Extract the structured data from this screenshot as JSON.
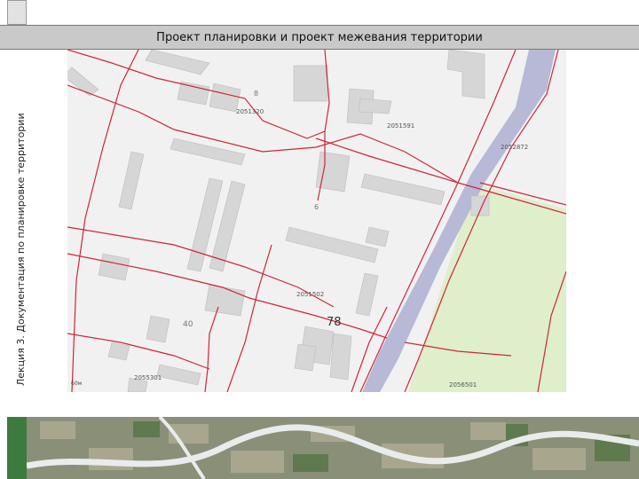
{
  "slide": {
    "title": "Проект планировки и проект межевания территории",
    "side_caption": "Лекция 3. Документация по планировке территории"
  },
  "map": {
    "labels": [
      {
        "id": "cad-2051320",
        "text": "2051320"
      },
      {
        "id": "cad-2051591",
        "text": "2051591"
      },
      {
        "id": "cad-2052872",
        "text": "2052872"
      },
      {
        "id": "cad-2051502",
        "text": "2051502"
      },
      {
        "id": "cad-2056501",
        "text": "2056501"
      },
      {
        "id": "cad-2055301",
        "text": "2055301"
      },
      {
        "id": "block-78",
        "text": "78"
      },
      {
        "id": "num-40",
        "text": "40"
      },
      {
        "id": "num-6",
        "text": "6"
      },
      {
        "id": "num-8",
        "text": "8"
      }
    ],
    "scale_text": "60м"
  },
  "colors": {
    "title_bar": "#c9c9c9",
    "map_bg": "#f1f1f1",
    "building": "#d6d6d6",
    "parcel_line": "#d0253a",
    "canal": "#b7b9d6",
    "park": "#dfeecb",
    "rail_stripe": "#3d7a3d"
  }
}
